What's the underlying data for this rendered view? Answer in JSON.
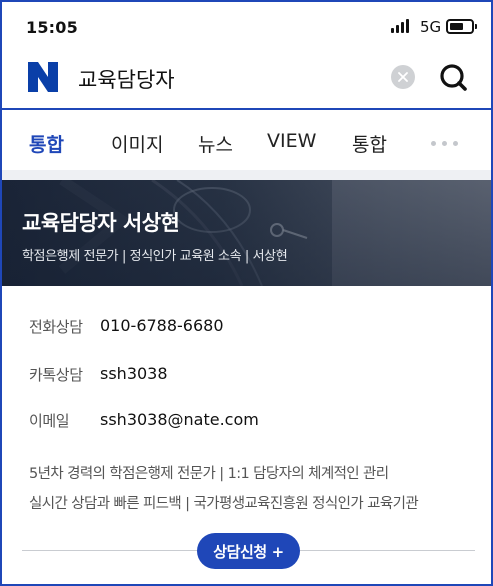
{
  "status_bar": {
    "time": "15:05",
    "network": "5G"
  },
  "search_bar": {
    "logo_letter": "N",
    "query": "교육담당자",
    "clear_icon": "clear-circle-icon",
    "search_icon": "search-icon"
  },
  "tabs": [
    {
      "label": "통합",
      "active": true
    },
    {
      "label": "이미지",
      "active": false
    },
    {
      "label": "뉴스",
      "active": false
    },
    {
      "label": "VIEW",
      "active": false
    },
    {
      "label": "통합",
      "active": false
    }
  ],
  "banner": {
    "title": "교육담당자 서상현",
    "subtitle": "학점은행제 전문가 | 정식인가 교육원 소속 | 서상현"
  },
  "contact": [
    {
      "label": "전화상담",
      "value": "010-6788-6680"
    },
    {
      "label": "카톡상담",
      "value": "ssh3038"
    },
    {
      "label": "이메일",
      "value": "ssh3038@nate.com"
    }
  ],
  "description": {
    "line1": "5년차 경력의 학점은행제 전문가  |  1:1 담당자의 체계적인 관리",
    "line2": "실시간 상담과 빠른 피드백  |  국가평생교육진흥원 정식인가 교육기관"
  },
  "cta": {
    "label": "상담신청 +"
  },
  "colors": {
    "brand": "#1f47b8",
    "logo": "#0a3fa8"
  }
}
